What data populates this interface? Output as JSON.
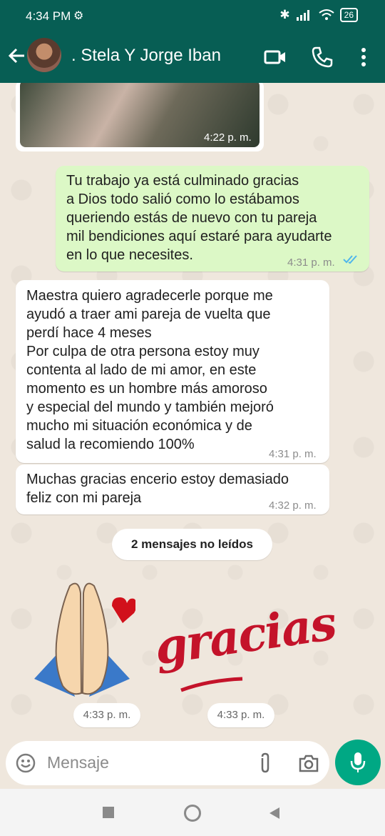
{
  "status": {
    "time": "4:34 PM",
    "battery": "26"
  },
  "header": {
    "contact_name": ". Stela Y Jorge Iban"
  },
  "messages": [
    {
      "time": "4:22 p. m."
    },
    {
      "text": [
        "Tu trabajo ya está culminado gracias",
        "a Dios todo salió como lo estábamos",
        "queriendo estás de nuevo con tu pareja",
        "mil bendiciones aquí estaré para ayudarte",
        "en lo que necesites."
      ],
      "time": "4:31 p. m."
    },
    {
      "text": [
        "Maestra quiero agradecerle porque me",
        "ayudó a traer ami pareja de vuelta que",
        "perdí hace 4 meses",
        "Por culpa de otra persona estoy muy",
        "contenta al lado de mi amor, en este",
        "momento es un hombre más amoroso",
        "y especial del mundo y también mejoró",
        "mucho mi situación económica y de",
        "salud la recomiendo 100%"
      ],
      "time": "4:31 p. m."
    },
    {
      "text": [
        "Muchas gracias encerio estoy demasiado",
        "feliz con mi pareja"
      ],
      "time": "4:32 p. m."
    }
  ],
  "unread_label": "2 mensajes no leídos",
  "stickers": [
    {
      "icon": "praying-hands-heart-sticker",
      "time": "4:33 p. m."
    },
    {
      "text": "gracias",
      "time": "4:33 p. m."
    }
  ],
  "input": {
    "placeholder": "Mensaje"
  }
}
